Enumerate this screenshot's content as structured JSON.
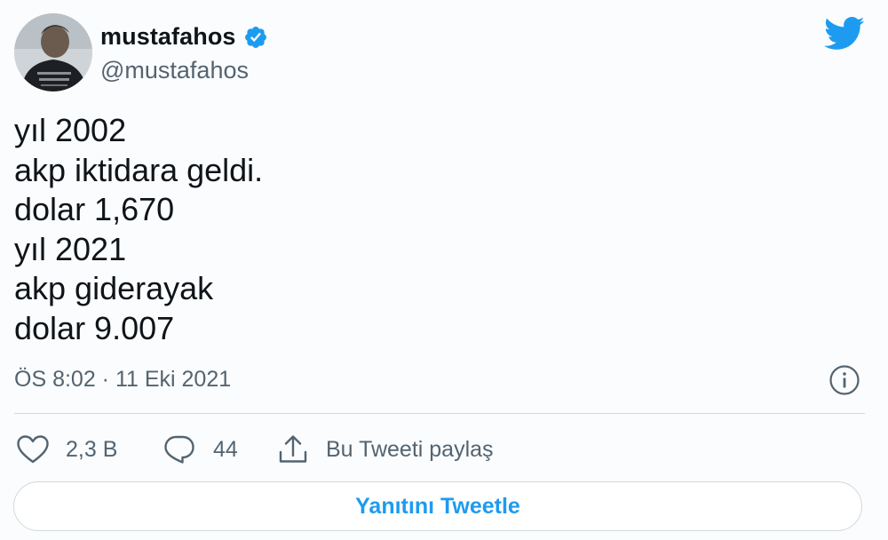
{
  "author": {
    "display_name": "mustafahos",
    "handle": "@mustafahos",
    "verified": true,
    "avatar_icon": "profile-photo"
  },
  "brand": {
    "logo_icon": "twitter-bird-icon",
    "accent_color": "#1d9bf0"
  },
  "tweet": {
    "lines": [
      "yıl 2002",
      "akp iktidara geldi.",
      "dolar 1,670",
      "yıl 2021",
      "akp giderayak",
      "dolar 9.007"
    ],
    "timestamp": "ÖS 8:02 · 11 Eki 2021"
  },
  "actions": {
    "like": {
      "icon": "heart-icon",
      "count": "2,3 B"
    },
    "reply": {
      "icon": "speech-bubble-icon",
      "count": "44"
    },
    "share": {
      "icon": "share-icon",
      "label": "Bu Tweeti paylaş"
    },
    "info_icon": "info-icon"
  },
  "reply_button": {
    "label": "Yanıtını Tweetle"
  },
  "colors": {
    "text_primary": "#0f1419",
    "text_secondary": "#536471",
    "border": "#cfd9de"
  }
}
